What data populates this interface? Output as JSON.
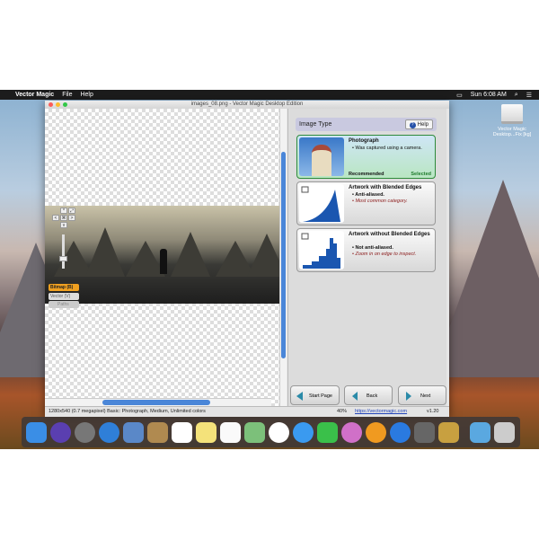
{
  "menubar": {
    "app": "Vector Magic",
    "items": [
      "File",
      "Help"
    ],
    "clock": "Sun 6:08 AM"
  },
  "desktop": {
    "drive_label": "Vector Magic Desktop...Fix [kg]"
  },
  "window": {
    "title": "images_08.png - Vector Magic Desktop Edition"
  },
  "canvas": {
    "nav": {
      "up": "^",
      "down": "v",
      "left": "<",
      "right": ">",
      "fit": "⌘",
      "full": "⤢"
    },
    "modes": {
      "bitmap": "Bitmap (B)",
      "vector": "Vector (V)",
      "paths": "Paths"
    }
  },
  "panel": {
    "header": "Image Type",
    "help": "Help",
    "cards": [
      {
        "title": "Photograph",
        "bullets": [
          "• Was captured using a camera."
        ],
        "recommended": "Recommended",
        "selected": "Selected"
      },
      {
        "title": "Artwork with Blended Edges",
        "bullets": [
          "• Anti-aliased.",
          "• Most common category."
        ]
      },
      {
        "title": "Artwork without Blended Edges",
        "bullets": [
          "• Not anti-aliased.",
          "• Zoom in on edge to inspect."
        ]
      }
    ],
    "buttons": {
      "start": "Start Page",
      "back": "Back",
      "next": "Next"
    }
  },
  "status": {
    "info": "1280x540 (0.7 megapixel)  Basic: Photograph, Medium, Unlimited colors",
    "zoom": "40%",
    "link": "https://vectormagic.com",
    "version": "v1.20"
  },
  "dock": [
    "Finder",
    "Siri",
    "Launchpad",
    "Safari",
    "Mail",
    "Contacts",
    "Calendar",
    "Notes",
    "Reminders",
    "Maps",
    "Photos",
    "Messages",
    "FaceTime",
    "iTunes",
    "iBooks",
    "App Store",
    "System Preferences",
    "Vector Magic",
    "Downloads",
    "Trash"
  ],
  "colors": {
    "accent": "#4a86d8",
    "selected": "#2d8a3a",
    "artwork": "#1a56b0"
  }
}
